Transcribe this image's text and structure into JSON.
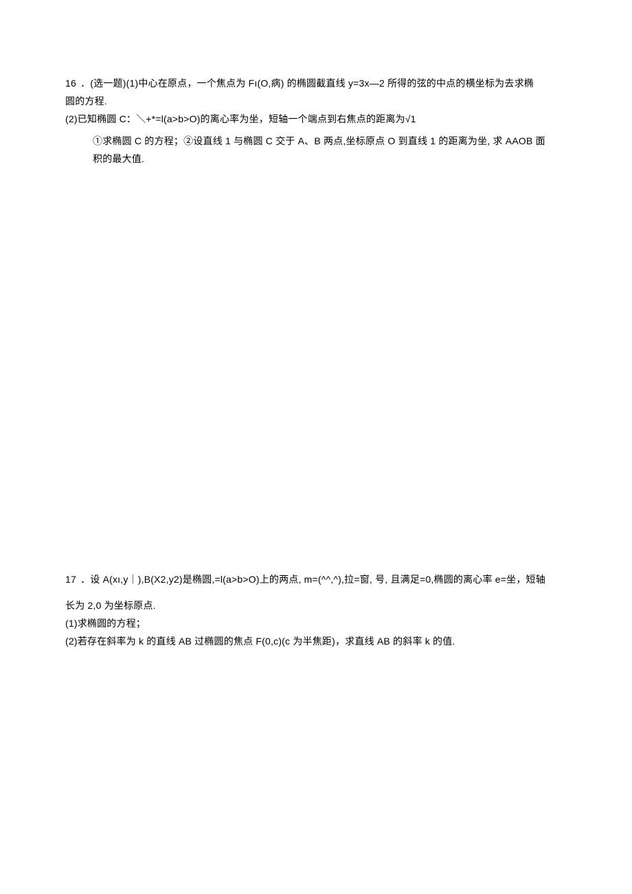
{
  "q16": {
    "number": "16",
    "l1a": "．(选一题)(1)中心在原点，一个焦点为 Fı(O,病) 的椭圆截直线 y=3x—2 所得的弦的中点的横坐标为去求椭",
    "l1b": "圆的方程.",
    "l2": "(2)已知椭圆 C：＼+*=l(a>b>O)的离心率为坐，短轴一个端点到右焦点的距离为√1",
    "l3": "①求椭圆 C 的方程；②设直线 1 与椭圆 C 交于 A、B 两点,坐标原点 O 到直线 1 的距离为坐, 求 AAOB 面",
    "l4": "积的最大值."
  },
  "q17": {
    "number": "17",
    "l1": "．设 A(xı,y｜),B(X2,y2)是椭圆,=l(a>b>O)上的两点, m=(^^,^),拉=窗, 号, 且满足=0,椭圆的离心率 e=坐，短轴",
    "l2": "长为 2,0 为坐标原点.",
    "l3": "(1)求椭圆的方程；",
    "l4": "(2)若存在斜率为 k 的直线 AB 过椭圆的焦点 F(0,c)(c 为半焦距)，求直线 AB 的斜率 k 的值."
  }
}
